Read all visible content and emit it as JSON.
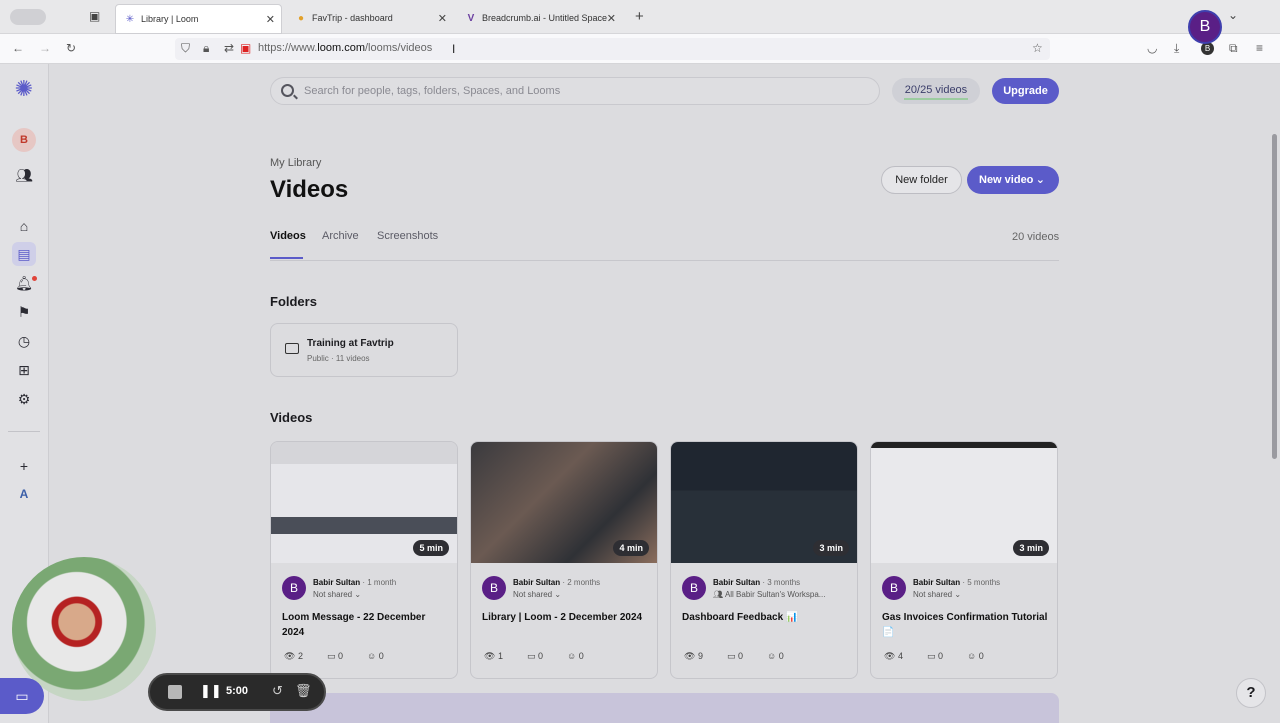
{
  "browser": {
    "tabs": [
      {
        "label": "Library | Loom",
        "active": true
      },
      {
        "label": "FavTrip - dashboard",
        "active": false
      },
      {
        "label": "Breadcrumb.ai - Untitled Space",
        "active": false
      }
    ],
    "url_prefix": "https://www.",
    "url_domain": "loom.com",
    "url_path": "/looms/videos"
  },
  "sidebar": {
    "workspace_initial": "B",
    "bottom_initial": "A",
    "icons": [
      "loom-logo-icon",
      "people-icon",
      "home-icon",
      "library-icon",
      "bell-icon",
      "bookmark-icon",
      "clock-icon",
      "gift-icon",
      "gear-icon",
      "plus-icon"
    ]
  },
  "header": {
    "search_placeholder": "Search for people, tags, folders, Spaces, and Looms",
    "video_quota": "20/25 videos",
    "quota_fraction": 0.8,
    "upgrade_label": "Upgrade",
    "user_initial": "B"
  },
  "library": {
    "breadcrumb": "My Library",
    "title": "Videos",
    "new_folder_label": "New folder",
    "new_video_label": "New video",
    "tabs": [
      "Videos",
      "Archive",
      "Screenshots"
    ],
    "video_count": "20 videos",
    "folders_heading": "Folders",
    "videos_heading": "Videos"
  },
  "folders": [
    {
      "name": "Training at Favtrip",
      "meta": "Public · 11 videos"
    }
  ],
  "videos": [
    {
      "duration": "5 min",
      "author": "Babir Sultan",
      "age": "1 month",
      "sharing": "Not shared ⌄",
      "title": "Loom Message - 22 December 2024",
      "views": "2",
      "comments": "0",
      "reactions": "0"
    },
    {
      "duration": "4 min",
      "author": "Babir Sultan",
      "age": "2 months",
      "sharing": "Not shared ⌄",
      "title": "Library | Loom - 2 December 2024",
      "views": "1",
      "comments": "0",
      "reactions": "0"
    },
    {
      "duration": "3 min",
      "author": "Babir Sultan",
      "age": "3 months",
      "sharing": "All Babir Sultan's Workspa...",
      "title": "Dashboard Feedback 📊",
      "views": "9",
      "comments": "0",
      "reactions": "0"
    },
    {
      "duration": "3 min",
      "author": "Babir Sultan",
      "age": "5 months",
      "sharing": "Not shared ⌄",
      "title": "Gas Invoices Confirmation Tutorial 📄",
      "views": "4",
      "comments": "0",
      "reactions": "0"
    }
  ],
  "recorder": {
    "timer": "5:00"
  },
  "help_label": "?"
}
